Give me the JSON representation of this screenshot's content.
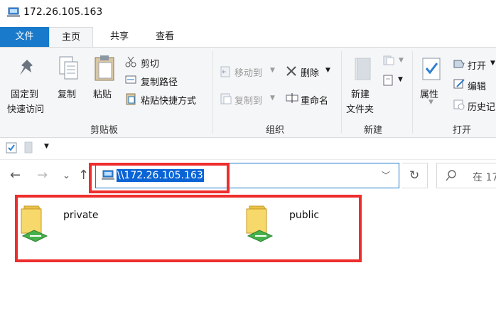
{
  "window": {
    "title": "172.26.105.163",
    "icon": "network-computer-icon"
  },
  "ribbon_tabs": {
    "file": "文件",
    "home": "主页",
    "share": "共享",
    "view": "查看"
  },
  "ribbon": {
    "clipboard": {
      "pin_line1": "固定到",
      "pin_line2": "快速访问",
      "copy": "复制",
      "paste": "粘贴",
      "cut": "剪切",
      "copy_path": "复制路径",
      "paste_shortcut": "粘贴快捷方式",
      "group": "剪贴板"
    },
    "organize": {
      "move_to": "移动到",
      "copy_to": "复制到",
      "delete": "删除",
      "rename": "重命名",
      "group": "组织"
    },
    "new": {
      "new_folder_line1": "新建",
      "new_folder_line2": "文件夹",
      "group": "新建"
    },
    "open": {
      "properties": "属性",
      "open": "打开",
      "edit": "编辑",
      "history": "历史记",
      "group": "打开"
    }
  },
  "addressbar": {
    "path": "\\\\172.26.105.163"
  },
  "search": {
    "placeholder": "在 17"
  },
  "folders": [
    {
      "name": "private",
      "icon": "network-share-folder-icon"
    },
    {
      "name": "public",
      "icon": "network-share-folder-icon"
    }
  ],
  "colors": {
    "accent": "#1979ca",
    "selection": "#0a64d6",
    "highlight_box": "#ee2d2d",
    "ribbon_bg": "#f5f6f7"
  }
}
